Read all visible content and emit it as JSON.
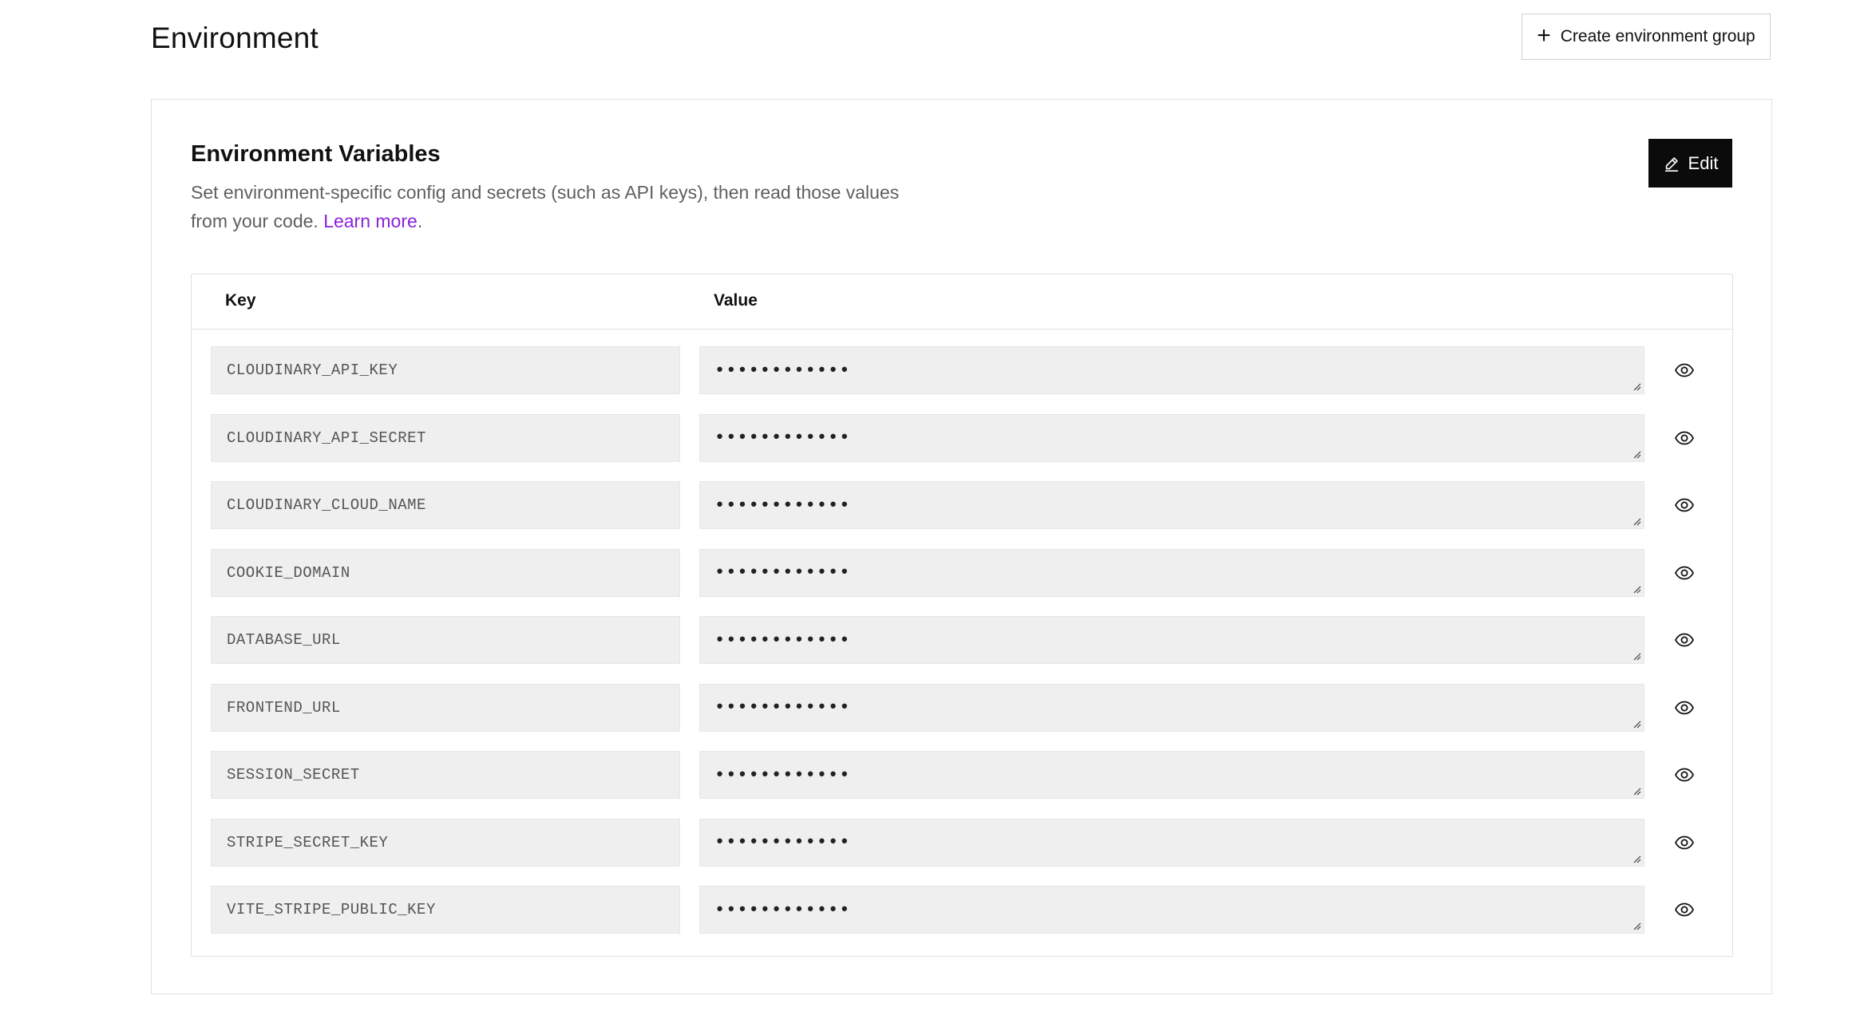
{
  "header": {
    "title": "Environment",
    "create_group_label": "Create environment group"
  },
  "card": {
    "title": "Environment Variables",
    "description": "Set environment-specific config and secrets (such as API keys), then read those values from your code.",
    "learn_more": "Learn more",
    "period": ".",
    "edit_label": "Edit"
  },
  "table": {
    "headers": {
      "key": "Key",
      "value": "Value"
    },
    "rows": [
      {
        "key": "CLOUDINARY_API_KEY",
        "value": "••••••••••••"
      },
      {
        "key": "CLOUDINARY_API_SECRET",
        "value": "••••••••••••"
      },
      {
        "key": "CLOUDINARY_CLOUD_NAME",
        "value": "••••••••••••"
      },
      {
        "key": "COOKIE_DOMAIN",
        "value": "••••••••••••"
      },
      {
        "key": "DATABASE_URL",
        "value": "••••••••••••"
      },
      {
        "key": "FRONTEND_URL",
        "value": "••••••••••••"
      },
      {
        "key": "SESSION_SECRET",
        "value": "••••••••••••"
      },
      {
        "key": "STRIPE_SECRET_KEY",
        "value": "••••••••••••"
      },
      {
        "key": "VITE_STRIPE_PUBLIC_KEY",
        "value": "••••••••••••"
      }
    ]
  },
  "icons": {
    "create_group": "plus-icon",
    "edit": "pencil-icon",
    "reveal": "eye-icon",
    "resize": "resize-handle-icon"
  },
  "colors": {
    "link": "#8a22d9",
    "edit_button_bg": "#0b0b0b",
    "input_bg": "#efefef"
  }
}
